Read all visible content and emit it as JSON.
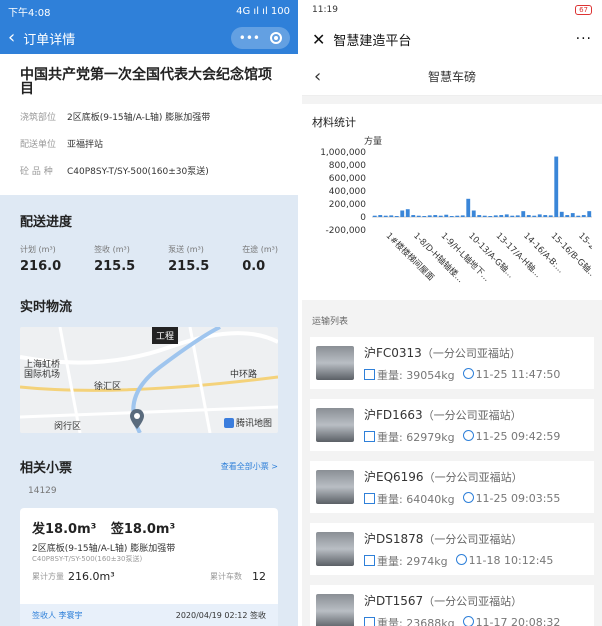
{
  "left": {
    "status_time": "下午4:08",
    "status_right": "4G ıl ıl 100",
    "nav_title": "订单详情",
    "nav_more": "•••",
    "order_title": "中国共产党第一次全国代表大会纪念馆项目",
    "info": [
      {
        "k": "浇筑部位",
        "v": "2区底板(9-15轴/A-L轴) 膨胀加强带"
      },
      {
        "k": "配送单位",
        "v": "亚福拌站"
      },
      {
        "k": "砼 品 种",
        "v": "C40P8SY-T/SY-500(160±30泵送)"
      }
    ],
    "delivery": {
      "title": "配送进度",
      "stats": [
        {
          "label": "计划 (m³)",
          "value": "216.0"
        },
        {
          "label": "签收 (m³)",
          "value": "215.5"
        },
        {
          "label": "泵送 (m³)",
          "value": "215.5"
        },
        {
          "label": "在途 (m³)",
          "value": "0.0"
        }
      ]
    },
    "logistics": {
      "title": "实时物流",
      "map_labels": {
        "a": "上海虹桥",
        "b": "国际机场",
        "c": "徐汇区",
        "d": "闵行区",
        "e": "中环路"
      },
      "map_tag": "工程",
      "map_brand": "腾讯地图"
    },
    "tickets": {
      "title": "相关小票",
      "link": "查看全部小票 >",
      "number": "14129",
      "send": "发18.0m³",
      "sign": "签18.0m³",
      "desc": "2区底板(9-15轴/A-L轴) 膨胀加强带",
      "sub": "C40P8SY-T/SY-500(160±30泵送)",
      "cum_label": "累计方量",
      "cum_value": "216.0m³",
      "cars_label": "累计车数",
      "cars_value": "12",
      "signer": "签收人 李寰宇",
      "sign_time": "2020/04/19 02:12 签收"
    }
  },
  "right": {
    "status_time": "11:19",
    "status_battery": "67",
    "app_title": "智慧建造平台",
    "page_title": "智慧车磅",
    "chart_card_title": "材料统计",
    "list_label": "运输列表",
    "trucks": [
      {
        "plate": "沪FC0313",
        "company": "（一分公司亚福站）",
        "weight": "重量: 39054kg",
        "time": "11-25 11:47:50"
      },
      {
        "plate": "沪FD1663",
        "company": "（一分公司亚福站）",
        "weight": "重量: 62979kg",
        "time": "11-25 09:42:59"
      },
      {
        "plate": "沪EQ6196",
        "company": "（一分公司亚福站）",
        "weight": "重量: 64040kg",
        "time": "11-25 09:03:55"
      },
      {
        "plate": "沪DS1878",
        "company": "（一分公司亚福站）",
        "weight": "重量: 2974kg",
        "time": "11-18 10:12:45"
      },
      {
        "plate": "沪DT1567",
        "company": "（一分公司亚福站）",
        "weight": "重量: 23688kg",
        "time": "11-17 20:08:32"
      }
    ]
  },
  "chart_data": {
    "type": "bar",
    "ylabel": "方量",
    "ylim": [
      -200000,
      1000000
    ],
    "yticks": [
      "1,000,000",
      "800,000",
      "600,000",
      "400,000",
      "200,000",
      "0",
      "-200,000"
    ],
    "categories": [
      "1#楼楼梯间屋面",
      "1-8/D-H轴轴楼...",
      "1-9/H-L轴地下...",
      "10-13/A-G轴...",
      "13-17/A-H轴...",
      "14-16/A-B:...",
      "15-16/B-G轴...",
      "15-20/..."
    ],
    "values": [
      20000,
      30000,
      20000,
      25000,
      15000,
      100000,
      120000,
      30000,
      20000,
      15000,
      25000,
      30000,
      20000,
      35000,
      15000,
      20000,
      25000,
      280000,
      100000,
      30000,
      20000,
      15000,
      25000,
      30000,
      40000,
      20000,
      25000,
      90000,
      30000,
      20000,
      40000,
      30000,
      25000,
      930000,
      80000,
      30000,
      60000,
      20000,
      30000,
      90000
    ],
    "bar_color": "#3a86d8"
  }
}
